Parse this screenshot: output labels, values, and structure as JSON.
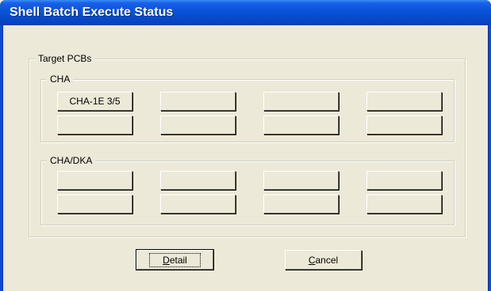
{
  "window": {
    "title": "Shell Batch Execute Status"
  },
  "target_group": {
    "label": "Target PCBs",
    "cha": {
      "label": "CHA",
      "buttons": [
        "CHA-1E 3/5",
        "",
        "",
        "",
        "",
        "",
        "",
        ""
      ]
    },
    "cha_dka": {
      "label": "CHA/DKA",
      "buttons": [
        "",
        "",
        "",
        "",
        "",
        "",
        "",
        ""
      ]
    }
  },
  "actions": {
    "detail": {
      "mnemonic": "D",
      "rest": "etail"
    },
    "cancel": {
      "mnemonic": "C",
      "rest": "ancel"
    }
  },
  "colors": {
    "titlebar": "#0853d8",
    "face": "#ece9d8"
  }
}
